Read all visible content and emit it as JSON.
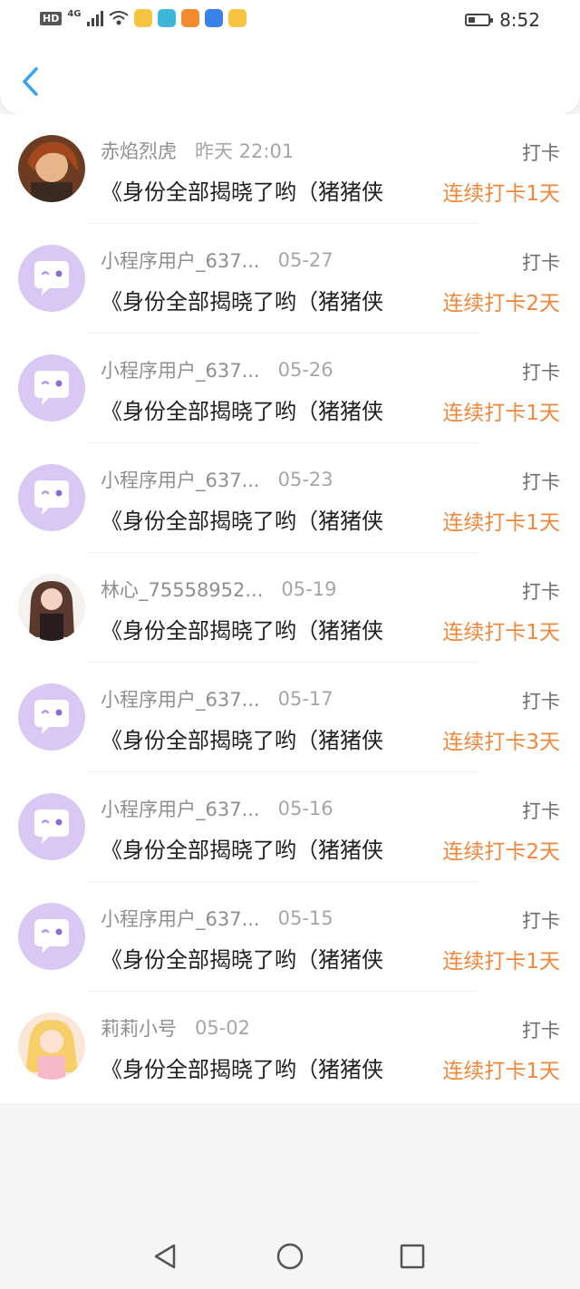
{
  "status_bar": {
    "hd": "HD",
    "network": "4G",
    "time": "8:52",
    "icons": [
      "signal-icon",
      "wifi-icon",
      "weibo-icon",
      "reader-icon",
      "video-icon",
      "qq-browser-icon",
      "weibo-icon",
      "battery-icon"
    ],
    "app_icon_colors": [
      "#f5c542",
      "#3db6d9",
      "#f28a2e",
      "#3b82e6",
      "#f5c542"
    ]
  },
  "header": {
    "back_icon": "chevron-left-icon",
    "accent_color": "#3aa3f0"
  },
  "colors": {
    "streak": "#f0873a",
    "default_avatar": "#d9c8f3"
  },
  "entries": [
    {
      "name": "赤焰烈虎",
      "date": "昨天 22:01",
      "type": "打卡",
      "title": "《身份全部揭晓了哟（猪猪侠",
      "streak": "连续打卡1天",
      "avatar": "anime-character-avatar"
    },
    {
      "name": "小程序用户_637...",
      "date": "05-27",
      "type": "打卡",
      "title": "《身份全部揭晓了哟（猪猪侠",
      "streak": "连续打卡2天",
      "avatar": "default-avatar"
    },
    {
      "name": "小程序用户_637...",
      "date": "05-26",
      "type": "打卡",
      "title": "《身份全部揭晓了哟（猪猪侠",
      "streak": "连续打卡1天",
      "avatar": "default-avatar"
    },
    {
      "name": "小程序用户_637...",
      "date": "05-23",
      "type": "打卡",
      "title": "《身份全部揭晓了哟（猪猪侠",
      "streak": "连续打卡1天",
      "avatar": "default-avatar"
    },
    {
      "name": "林心_75558952...",
      "date": "05-19",
      "type": "打卡",
      "title": "《身份全部揭晓了哟（猪猪侠",
      "streak": "连续打卡1天",
      "avatar": "girl-photo-avatar"
    },
    {
      "name": "小程序用户_637...",
      "date": "05-17",
      "type": "打卡",
      "title": "《身份全部揭晓了哟（猪猪侠",
      "streak": "连续打卡3天",
      "avatar": "default-avatar"
    },
    {
      "name": "小程序用户_637...",
      "date": "05-16",
      "type": "打卡",
      "title": "《身份全部揭晓了哟（猪猪侠",
      "streak": "连续打卡2天",
      "avatar": "default-avatar"
    },
    {
      "name": "小程序用户_637...",
      "date": "05-15",
      "type": "打卡",
      "title": "《身份全部揭晓了哟（猪猪侠",
      "streak": "连续打卡1天",
      "avatar": "default-avatar"
    },
    {
      "name": "莉莉小号",
      "date": "05-02",
      "type": "打卡",
      "title": "《身份全部揭晓了哟（猪猪侠",
      "streak": "连续打卡1天",
      "avatar": "anime-girl-avatar"
    }
  ],
  "navbar": {
    "icons": [
      "back-triangle-icon",
      "home-circle-icon",
      "recents-square-icon"
    ]
  }
}
